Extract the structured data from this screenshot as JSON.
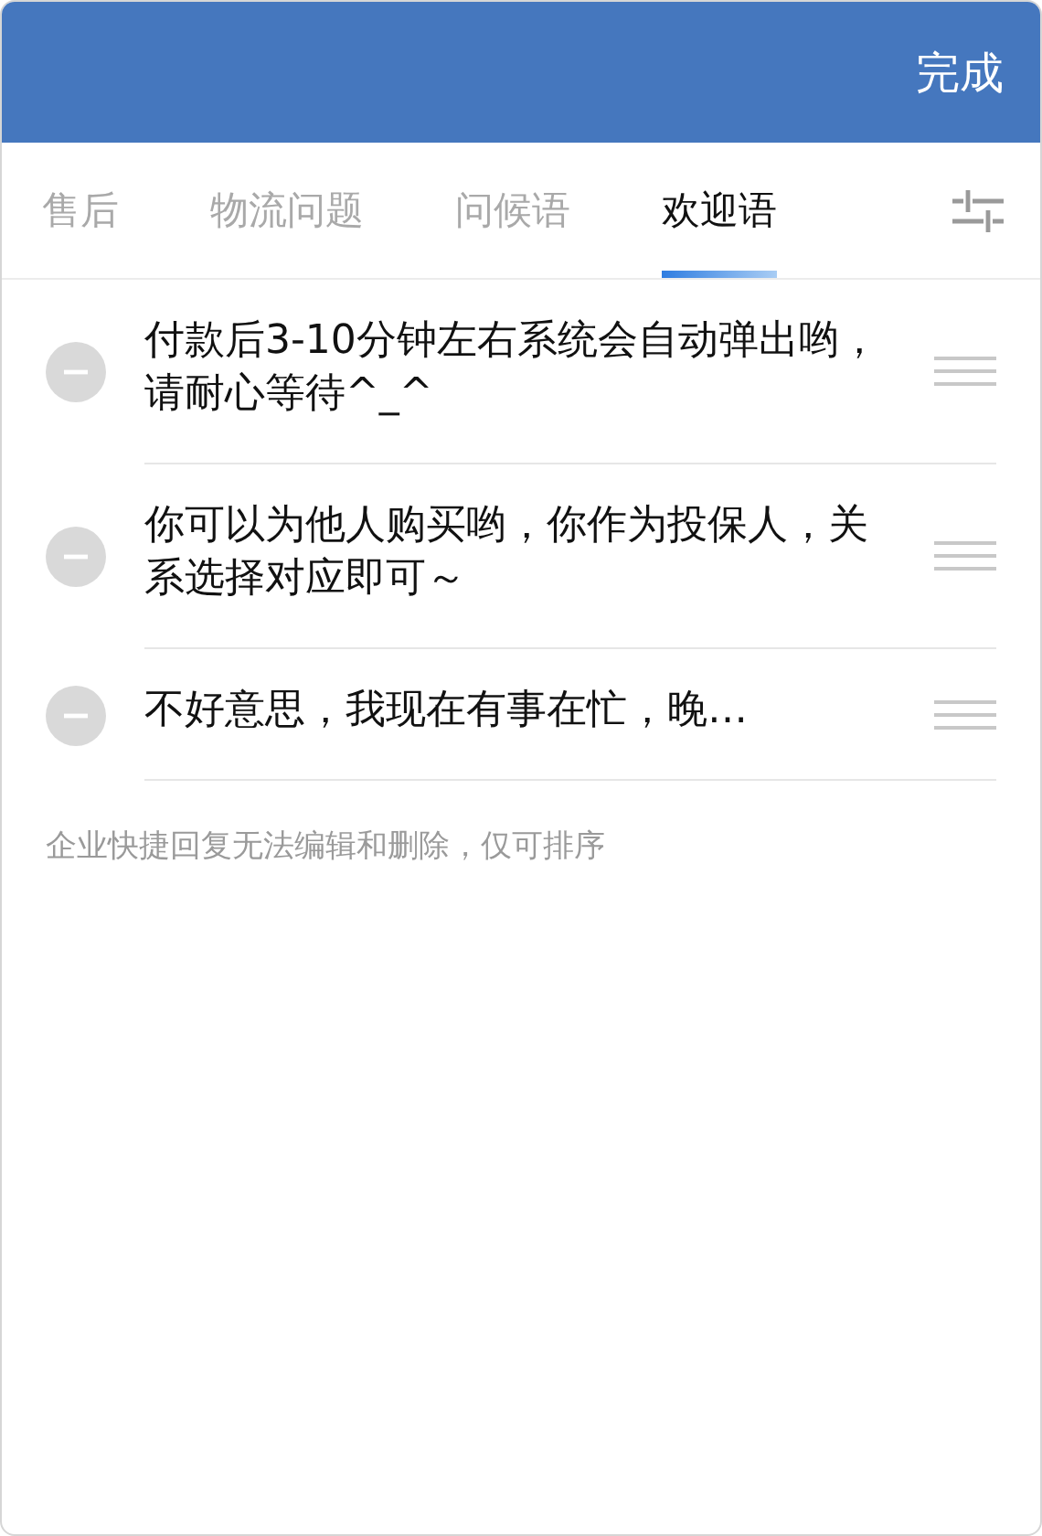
{
  "header": {
    "done_button": "完成"
  },
  "tabs": [
    {
      "label": "售后",
      "selected": false
    },
    {
      "label": "物流问题",
      "selected": false
    },
    {
      "label": "问候语",
      "selected": false
    },
    {
      "label": "欢迎语",
      "selected": true
    }
  ],
  "replies": [
    {
      "text": "付款后3-10分钟左右系统会自动弹出哟，请耐心等待^_^"
    },
    {
      "text": "你可以为他人购买哟，你作为投保人，关系选择对应即可～"
    },
    {
      "text": "不好意思，我现在有事在忙，晚…"
    }
  ],
  "note": "企业快捷回复无法编辑和删除，仅可排序"
}
